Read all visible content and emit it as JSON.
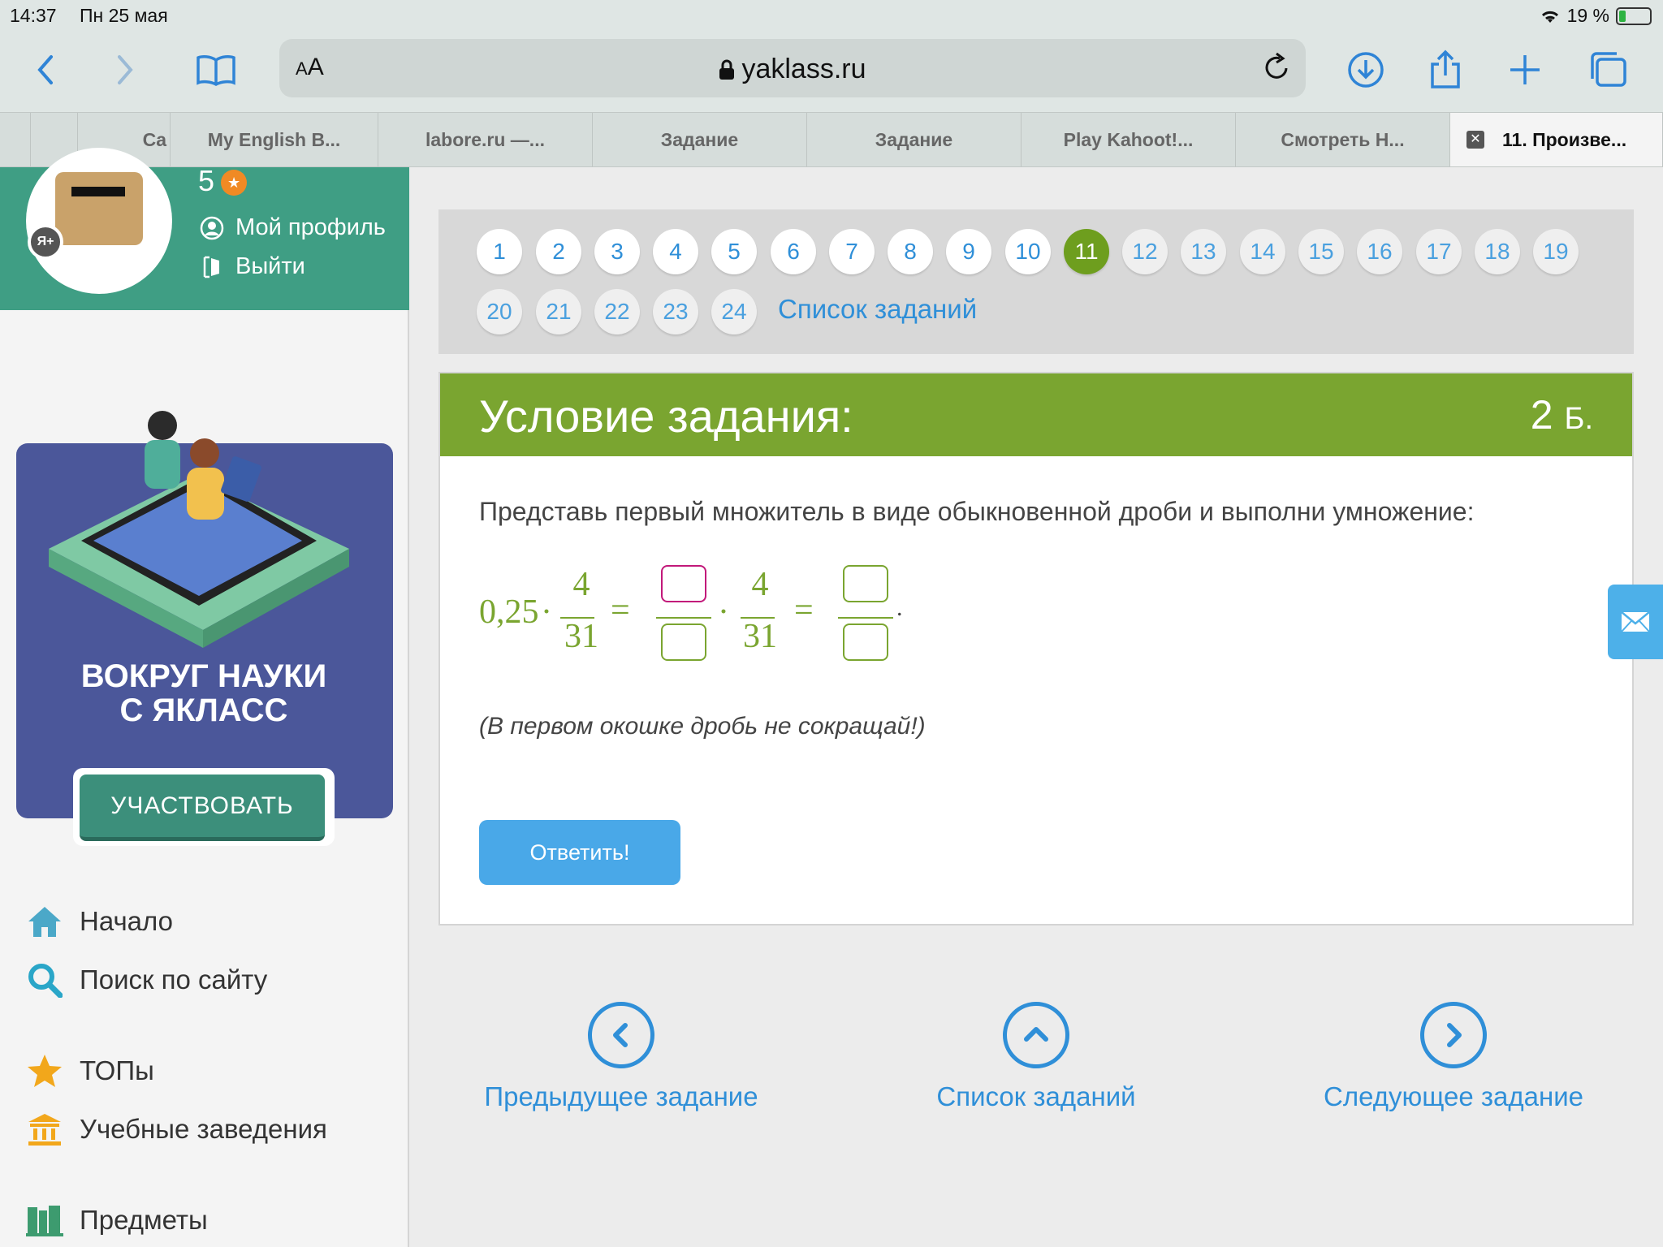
{
  "statusbar": {
    "time": "14:37",
    "date": "Пн 25 мая",
    "battery": "19 %"
  },
  "browser": {
    "aa_small": "A",
    "aa_big": "A",
    "url": "yaklass.ru",
    "tabs": [
      {
        "label": "",
        "active": false
      },
      {
        "label": "",
        "active": false
      },
      {
        "label": "Ca",
        "active": false
      },
      {
        "label": "My English B...",
        "active": false
      },
      {
        "label": "labore.ru —...",
        "active": false
      },
      {
        "label": "Задание",
        "active": false
      },
      {
        "label": "Задание",
        "active": false
      },
      {
        "label": "Play Kahoot!...",
        "active": false
      },
      {
        "label": "Смотреть Н...",
        "active": false
      },
      {
        "label": "11. Произве...",
        "active": true
      }
    ]
  },
  "sidebar": {
    "level": "5",
    "badge": "Я+",
    "profile_link": "Мой профиль",
    "logout_link": "Выйти",
    "promo_title_line1": "ВОКРУГ НАУКИ",
    "promo_title_line2": "С ЯКЛАСС",
    "participate": "УЧАСТВОВАТЬ",
    "nav": {
      "home": "Начало",
      "search": "Поиск по сайту",
      "tops": "ТОПы",
      "schools": "Учебные заведения",
      "subjects": "Предметы"
    }
  },
  "numbers": {
    "current": "11",
    "task_list": "Список заданий"
  },
  "task": {
    "title": "Условие задания:",
    "points": "2",
    "points_unit": "Б.",
    "text": "Представь первый множитель в виде обыкновенной дроби и выполни умножение:",
    "formula": {
      "decimal": "0,25",
      "dot": "·",
      "num": "4",
      "den": "31",
      "eq": "=",
      "end": "."
    },
    "hint": "(В первом окошке дробь не сокращай!)",
    "answer_button": "Ответить!"
  },
  "bottom_nav": {
    "prev": "Предыдущее задание",
    "list": "Список заданий",
    "next": "Следующее задание"
  },
  "colors": {
    "accent_green": "#7aa530",
    "link_blue": "#2f8fd8",
    "sidebar_green": "#3f9e84",
    "answer_button": "#49a8e8"
  }
}
